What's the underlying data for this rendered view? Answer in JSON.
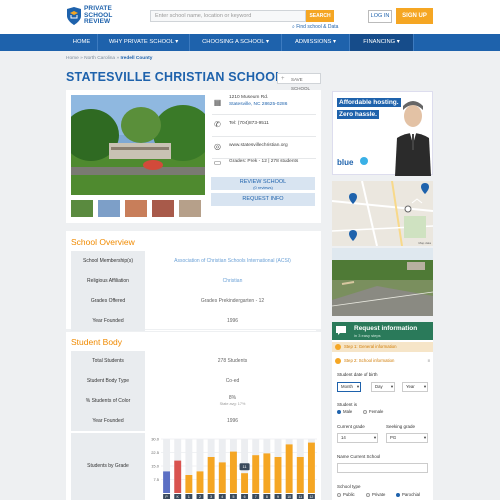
{
  "logo": {
    "line1": "PRIVATE",
    "line2": "SCHOOL",
    "line3": "REVIEW"
  },
  "search": {
    "placeholder": "Enter school name, location or keyword",
    "button": "SEARCH",
    "find_link": "Find school & Data"
  },
  "auth": {
    "login": "LOG IN",
    "signup": "SIGN UP"
  },
  "nav": [
    {
      "label": "HOME"
    },
    {
      "label": "WHY PRIVATE SCHOOL ▾"
    },
    {
      "label": "CHOOSING A SCHOOL ▾"
    },
    {
      "label": "ADMISSIONS ▾"
    },
    {
      "label": "FINANCING ▾"
    }
  ],
  "breadcrumb": {
    "part1": "Home",
    "sep1": "»",
    "part2": "North Carolina",
    "sep2": "»",
    "current": "Iredell County"
  },
  "school": {
    "name": "STATESVILLE CHRISTIAN SCHOOL",
    "save_label": "SAVE SCHOOL",
    "address1": "1210 Museum Rd.",
    "address2": "Statesville, NC 28625-0286",
    "phone": "Tel: (704)873-9511",
    "website": "www.statesvillechristian.org",
    "grades_students": "Grades: Prek - 12 | 278 students",
    "review_btn": "REVIEW SCHOOL",
    "review_count": "(0 reviews)",
    "request_btn": "REQUEST INFO"
  },
  "overview": {
    "heading": "School Overview",
    "rows": [
      {
        "k": "School Membership(s)",
        "v": "Association of Christian Schools International (ACSI)"
      },
      {
        "k": "Religious Affiliation",
        "v": "Christian"
      },
      {
        "k": "Grades Offered",
        "v": "Grades Prekindergarten - 12"
      },
      {
        "k": "Year Founded",
        "v": "1996"
      }
    ]
  },
  "body": {
    "heading": "Student Body",
    "rows": [
      {
        "k": "Total Students",
        "v": "278 Students"
      },
      {
        "k": "Student Body Type",
        "v": "Co-ed"
      },
      {
        "k": "% Students of Color",
        "v": "8%",
        "sub": "State avg: 17%"
      },
      {
        "k": "Year Founded",
        "v": "1996"
      }
    ],
    "chart_row_label": "Students by Grade"
  },
  "ad": {
    "line1": "Affordable hosting.",
    "line2": "Zero hassle.",
    "brand": "blue"
  },
  "map": {
    "label": "Map data"
  },
  "request_panel": {
    "title": "Request information",
    "subtitle": "in 3 easy steps",
    "step1": "Step 1: General information",
    "step2": "Step 2: School information",
    "dob_label": "Student date of birth",
    "month": "Month",
    "day": "Day",
    "year": "Year",
    "student_is": "Student is",
    "male": "Male",
    "female": "Female",
    "current_grade_label": "Current grade",
    "seeking_grade_label": "Seeking grade",
    "current_grade": "14",
    "seeking_grade": "PG",
    "name_current_school": "Name Current School",
    "school_type": "School type",
    "public": "Public",
    "private": "Private",
    "parochial": "Parochial"
  },
  "chart_data": {
    "type": "bar",
    "categories": [
      "P",
      "K",
      "1",
      "2",
      "3",
      "4",
      "5",
      "6",
      "7",
      "8",
      "9",
      "10",
      "11",
      "12"
    ],
    "values": [
      12,
      18,
      10,
      12,
      20,
      17,
      23,
      11,
      21,
      22,
      20,
      27,
      20,
      28
    ],
    "highlight_colors": [
      "#5b6fc4",
      "#d9534f",
      "#f5a623",
      "#f5a623",
      "#f5a623",
      "#f5a623",
      "#f5a623",
      "#f5a623",
      "#f5a623",
      "#f5a623",
      "#f5a623",
      "#f5a623",
      "#f5a623",
      "#f5a623"
    ],
    "y_ticks": [
      "30.0",
      "22.5",
      "15.0",
      "7.5"
    ],
    "ylim": [
      0,
      30
    ],
    "tooltip": "11",
    "grid": true
  }
}
